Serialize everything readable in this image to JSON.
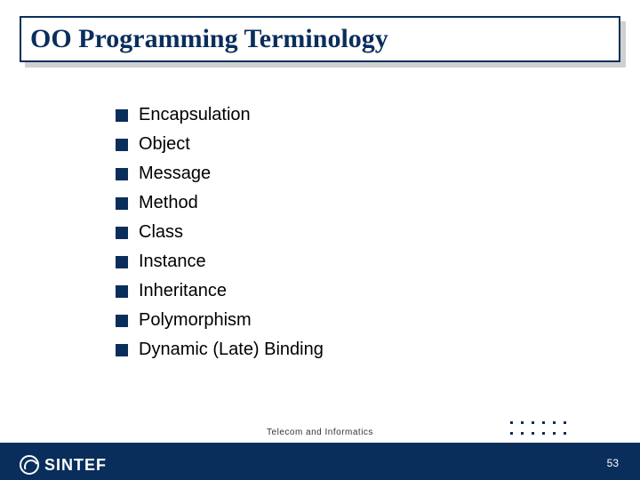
{
  "title": "OO Programming Terminology",
  "bullets": [
    "Encapsulation",
    "Object",
    "Message",
    "Method",
    "Class",
    "Instance",
    "Inheritance",
    "Polymorphism",
    "Dynamic (Late) Binding"
  ],
  "footer": {
    "department": "Telecom and Informatics",
    "page_number": "53",
    "logo_text": "SINTEF"
  },
  "colors": {
    "brand_navy": "#0a2e5c"
  }
}
